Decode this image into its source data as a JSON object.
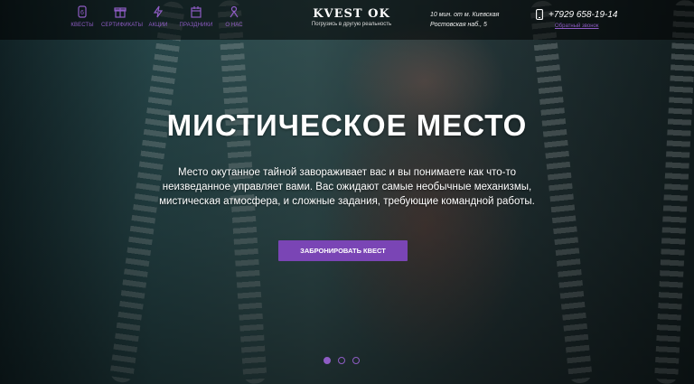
{
  "header": {
    "nav": [
      {
        "label": "КВЕСТЫ",
        "icon": "number-6-icon"
      },
      {
        "label": "СЕРТИФИКАТЫ",
        "icon": "gift-icon"
      },
      {
        "label": "АКЦИИ",
        "icon": "lightning-icon"
      },
      {
        "label": "ПРАЗДНИКИ",
        "icon": "calendar-icon"
      },
      {
        "label": "О НАС",
        "icon": "person-icon"
      }
    ],
    "logo": {
      "name": "KVEST OK",
      "tagline": "Погрузись в другую реальность"
    },
    "address": {
      "line1": "10 мин. от м. Киевская",
      "line2": "Ростовская наб., 5"
    },
    "phone": "+7929 658-19-14",
    "callback": "Обратный звонок"
  },
  "hero": {
    "title": "МИСТИЧЕСКОЕ МЕСТО",
    "description": "Место окутанное тайной завораживает вас и вы понимаете как что-то неизведанное управляет вами. Вас ожидают самые необычные механизмы, мистическая атмосфера, и сложные задания, требующие командной работы.",
    "button": "ЗАБРОНИРОВАТЬ КВЕСТ"
  },
  "slider": {
    "slides": 3,
    "active": 1
  },
  "colors": {
    "accent": "#7a45b5",
    "accent_light": "#8e5cc4"
  }
}
